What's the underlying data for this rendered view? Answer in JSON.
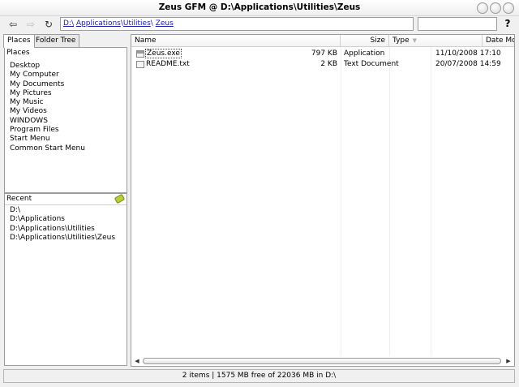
{
  "window": {
    "title": "Zeus GFM @ D:\\Applications\\Utilities\\Zeus"
  },
  "toolbar": {
    "back_icon": "arrow-left-icon",
    "forward_icon": "arrow-right-icon",
    "refresh_icon": "refresh-icon",
    "address_crumbs": [
      "D:\\",
      "Applications",
      "Utilities",
      "Zeus"
    ],
    "crumb_separator": "\\",
    "search_value": "",
    "help_label": "?"
  },
  "sidebar": {
    "tabs": [
      {
        "label": "Places",
        "active": true
      },
      {
        "label": "Folder Tree",
        "active": false
      }
    ],
    "places_header": "Places",
    "places": [
      "Desktop",
      "My Computer",
      "My Documents",
      "My Pictures",
      "My Music",
      "My Videos",
      "WINDOWS",
      "Program Files",
      "Start Menu",
      "Common Start Menu"
    ],
    "recent_header": "Recent",
    "recent": [
      "D:\\",
      "D:\\Applications",
      "D:\\Applications\\Utilities",
      "D:\\Applications\\Utilities\\Zeus"
    ]
  },
  "files": {
    "columns": {
      "name": "Name",
      "size": "Size",
      "type": "Type",
      "date": "Date Modified"
    },
    "rows": [
      {
        "name": "Zeus.exe",
        "size": "797 KB",
        "type": "Application",
        "date": "11/10/2008 17:10",
        "icon": "application-icon"
      },
      {
        "name": "README.txt",
        "size": "2 KB",
        "type": "Text Document",
        "date": "20/07/2008 14:59",
        "icon": "text-file-icon"
      }
    ]
  },
  "status": {
    "text": "2 items | 1575 MB free of 22036 MB in D:\\"
  },
  "colors": {
    "link": "#1a1aa6",
    "border": "#9c9c9c",
    "background": "#f0f0f0"
  }
}
